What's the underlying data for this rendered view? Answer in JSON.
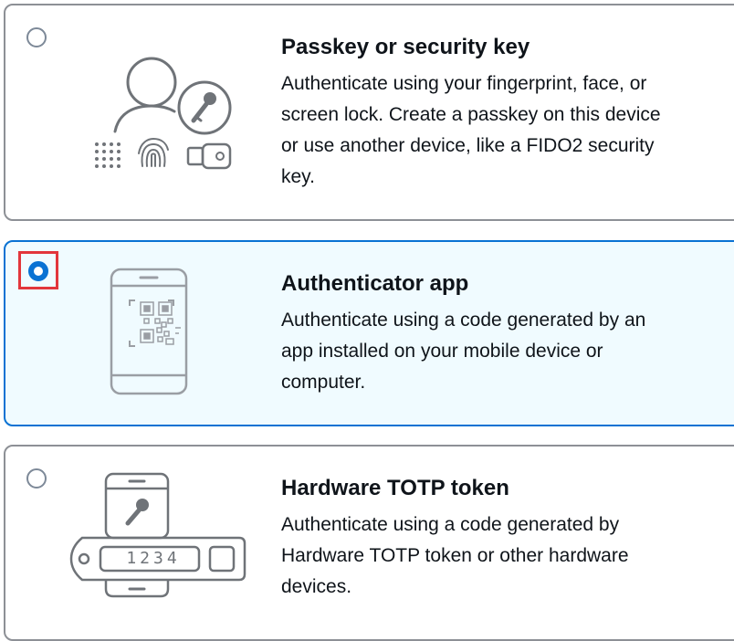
{
  "options": [
    {
      "id": "passkey",
      "title": "Passkey or security key",
      "description_lines": [
        "Authenticate using your fingerprint, face, or",
        "screen lock. Create a passkey on this device",
        "or use another device, like a FIDO2 security",
        "key."
      ],
      "selected": false,
      "icon": "passkey-illustration"
    },
    {
      "id": "authenticator-app",
      "title": "Authenticator app",
      "description_lines": [
        "Authenticate using a code generated by an",
        "app installed on your mobile device or",
        "computer."
      ],
      "selected": true,
      "icon": "phone-qr-illustration"
    },
    {
      "id": "hardware-totp",
      "title": "Hardware TOTP token",
      "description_lines": [
        "Authenticate using a code generated by",
        "Hardware TOTP token or other hardware",
        "devices."
      ],
      "selected": false,
      "icon": "hardware-token-illustration",
      "token_display": "1234"
    }
  ],
  "colors": {
    "selected_accent": "#0972d3",
    "selected_background": "#f0fbff",
    "border": "#8d9096",
    "focus_ring": "#e2363c"
  }
}
